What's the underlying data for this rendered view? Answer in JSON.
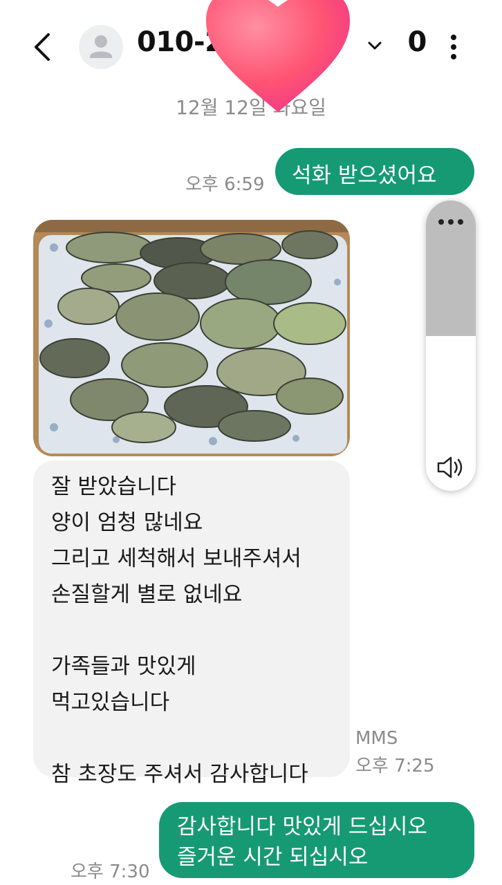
{
  "header": {
    "contact_visible": "010-2",
    "contact_tail": "0",
    "back_icon": "chevron-left-icon",
    "avatar_icon": "person-icon",
    "menu_icon": "more-vertical-icon",
    "overlay": "heart-sticker"
  },
  "date_divider": "12월 12일 화요일",
  "messages": [
    {
      "direction": "outgoing",
      "text": "석화 받으셨어요",
      "time": "오후 6:59"
    },
    {
      "direction": "incoming",
      "type": "image",
      "image": "oysters-on-tray-photo"
    },
    {
      "direction": "incoming",
      "text": "잘 받았습니다\n양이 엄청 많네요\n그리고 세척해서 보내주셔서\n손질할게 별로 없네요\n\n가족들과 맛있게\n먹고있습니다\n\n참 초장도 주셔서 감사합니다",
      "badge": "MMS",
      "time": "오후 7:25"
    },
    {
      "direction": "outgoing",
      "text": "감사합니다 맛있게 드십시오\n즐거운  시간  되십시오",
      "time": "오후 7:30"
    }
  ],
  "volume_panel": {
    "level": 0.5,
    "more_icon": "more-horizontal-icon",
    "speaker_icon": "speaker-icon"
  },
  "colors": {
    "outgoing_bubble": "#169a74",
    "incoming_bubble": "#f2f2f2",
    "meta_text": "#8a8a8a"
  }
}
